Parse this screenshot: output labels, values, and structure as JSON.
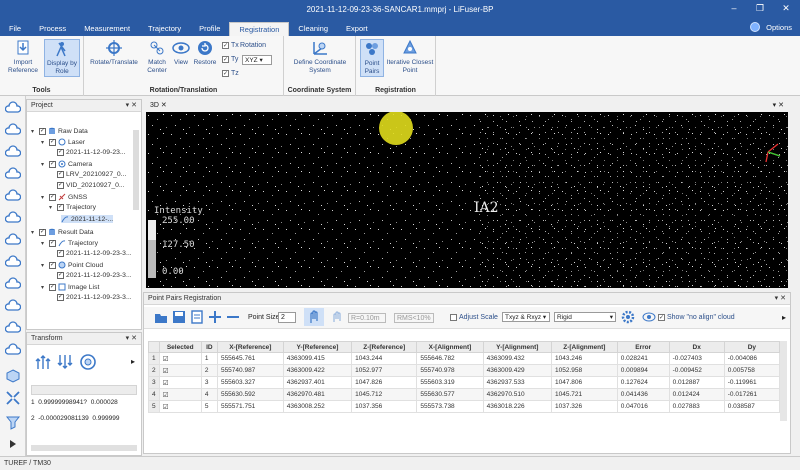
{
  "window": {
    "title": "2021-11-12-09-23-36-SANCAR1.mmprj - LiFuser-BP",
    "minimize": "–",
    "restore": "❐",
    "close": "✕"
  },
  "menu": {
    "tabs": [
      "File",
      "Process",
      "Measurement",
      "Trajectory",
      "Profile",
      "Registration",
      "Cleaning",
      "Export"
    ],
    "active_index": 5,
    "options_label": "Options"
  },
  "ribbon": {
    "tools": {
      "title": "Tools",
      "import_reference": "Import\nReference",
      "display_by_role": "Display by\nRole"
    },
    "rotation": {
      "title": "Rotation/Translation",
      "rotate_translate": "Rotate/Translate",
      "match_center": "Match\nCenter",
      "view": "View",
      "restore": "Restore",
      "chk_tx": "Tx",
      "chk_ty": "Ty",
      "chk_tz": "Tz",
      "rotation_label": "Rotation",
      "rotation_value": "XYZ"
    },
    "coordsys": {
      "title": "Coordinate System",
      "define": "Define Coordinate\nSystem"
    },
    "registration": {
      "title": "Registration",
      "point_pairs": "Point\nPairs",
      "iterative": "Iterative Closest\nPoint"
    }
  },
  "project": {
    "title": "Project",
    "items": [
      {
        "label": "Raw Data"
      },
      {
        "label": "Laser"
      },
      {
        "label": "2021-11-12-09-23..."
      },
      {
        "label": "Camera"
      },
      {
        "label": "LRV_20210927_0..."
      },
      {
        "label": "VID_20210927_0..."
      },
      {
        "label": "GNSS"
      },
      {
        "label": "Trajectory"
      },
      {
        "label": "2021-11-12-..."
      },
      {
        "label": "Result Data"
      },
      {
        "label": "Trajectory"
      },
      {
        "label": "2021-11-12-09-23-3..."
      },
      {
        "label": "Point Cloud"
      },
      {
        "label": "2021-11-12-09-23-3..."
      },
      {
        "label": "Image List"
      },
      {
        "label": "2021-11-12-09-23-3..."
      }
    ]
  },
  "view3d": {
    "tab": "3D",
    "legend_title": "Intensity",
    "legend_max": "255.00",
    "legend_mid": "127.50",
    "legend_min": "0.00",
    "marker_label": "IA2"
  },
  "transform": {
    "title": "Transform",
    "rows": [
      {
        "index": "1",
        "c1": "0.99999998941?",
        "c2": "0.000028"
      },
      {
        "index": "2",
        "c1": "-0.000029081139",
        "c2": "0.999999"
      }
    ]
  },
  "pointpairs": {
    "title": "Point Pairs Registration",
    "point_size_label": "Point Size",
    "point_size_value": "2",
    "r_label": "R=0.10m",
    "rms_label": "RMS<10%",
    "adjust_scale": "Adjust Scale",
    "mode_value": "Txyz & Rxyz",
    "method_value": "Rigid",
    "show_no_align": "Show \"no align\" cloud",
    "columns": [
      "Selected",
      "ID",
      "X-[Reference]",
      "Y-[Reference]",
      "Z-[Reference]",
      "X-[Alignment]",
      "Y-[Alignment]",
      "Z-[Alignment]",
      "Error",
      "Dx",
      "Dy"
    ],
    "rows": [
      {
        "row": "1",
        "sel": "☑",
        "id": "1",
        "xr": "555645.761",
        "yr": "4363099.415",
        "zr": "1043.244",
        "xa": "555646.782",
        "ya": "4363099.432",
        "za": "1043.246",
        "err": "0.028241",
        "dx": "-0.027403",
        "dy": "-0.004086"
      },
      {
        "row": "2",
        "sel": "☑",
        "id": "2",
        "xr": "555740.987",
        "yr": "4363009.422",
        "zr": "1052.977",
        "xa": "555740.978",
        "ya": "4363009.429",
        "za": "1052.958",
        "err": "0.009894",
        "dx": "-0.009452",
        "dy": "0.005758"
      },
      {
        "row": "3",
        "sel": "☑",
        "id": "3",
        "xr": "555603.327",
        "yr": "4362937.401",
        "zr": "1047.826",
        "xa": "555603.319",
        "ya": "4362937.533",
        "za": "1047.806",
        "err": "0.127624",
        "dx": "0.012887",
        "dy": "-0.119961"
      },
      {
        "row": "4",
        "sel": "☑",
        "id": "4",
        "xr": "555630.592",
        "yr": "4362970.481",
        "zr": "1045.712",
        "xa": "555630.577",
        "ya": "4362970.510",
        "za": "1045.721",
        "err": "0.041436",
        "dx": "0.012424",
        "dy": "-0.017261"
      },
      {
        "row": "5",
        "sel": "☑",
        "id": "5",
        "xr": "555571.751",
        "yr": "4363008.252",
        "zr": "1037.356",
        "xa": "555573.738",
        "ya": "4363018.226",
        "za": "1037.326",
        "err": "0.047016",
        "dx": "0.027883",
        "dy": "0.038587"
      }
    ]
  },
  "status": {
    "text": "TUREF / TM30"
  },
  "colors": {
    "titlebar": "#2a5aa3",
    "accent_icon": "#3c78c8",
    "marker": "#e0dc1c"
  }
}
